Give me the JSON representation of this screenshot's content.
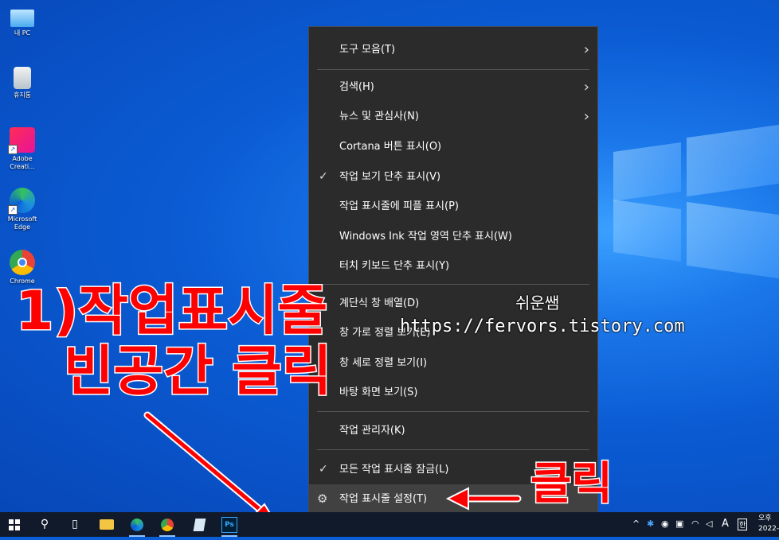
{
  "desktop_icons": [
    {
      "name": "this-pc",
      "label": "내 PC"
    },
    {
      "name": "recycle-bin",
      "label": "휴지통"
    },
    {
      "name": "adobe-cc",
      "label": "Adobe Creati..."
    },
    {
      "name": "edge",
      "label": "Microsoft Edge"
    },
    {
      "name": "chrome",
      "label": "Chrome"
    }
  ],
  "menu": {
    "items": [
      {
        "label": "도구 모음(T)",
        "submenu": true
      },
      {
        "label": "검색(H)",
        "submenu": true
      },
      {
        "label": "뉴스 및 관심사(N)",
        "submenu": true
      },
      {
        "label": "Cortana 버튼 표시(O)"
      },
      {
        "label": "작업 보기 단추 표시(V)",
        "checked": true
      },
      {
        "label": "작업 표시줄에 피플 표시(P)"
      },
      {
        "label": "Windows Ink 작업 영역 단추 표시(W)"
      },
      {
        "label": "터치 키보드 단추 표시(Y)"
      },
      {
        "label": "계단식 창 배열(D)"
      },
      {
        "label": "창 가로 정렬 보기(E)"
      },
      {
        "label": "창 세로 정렬 보기(I)"
      },
      {
        "label": "바탕 화면 보기(S)"
      },
      {
        "label": "작업 관리자(K)"
      },
      {
        "label": "모든 작업 표시줄 잠금(L)",
        "checked": true
      },
      {
        "label": "작업 표시줄 설정(T)",
        "icon": "gear-icon",
        "highlighted": true
      }
    ],
    "check_glyph": "✓",
    "chevron_glyph": "›",
    "gear_glyph": "⚙"
  },
  "annotations": {
    "line1": "1)작업표시줄",
    "line2": "빈공간 클릭",
    "click": "클릭",
    "watermark_name": "쉬운쌤",
    "watermark_url": "https://fervors.tistory.com"
  },
  "taskbar": {
    "tray_lang": "A",
    "tray_ime": "한",
    "clock_time": "오후",
    "clock_date": "2022-"
  },
  "colors": {
    "annotation": "#ff0000",
    "menu_bg": "#2b2b2b",
    "taskbar_bg": "#101a2a"
  }
}
